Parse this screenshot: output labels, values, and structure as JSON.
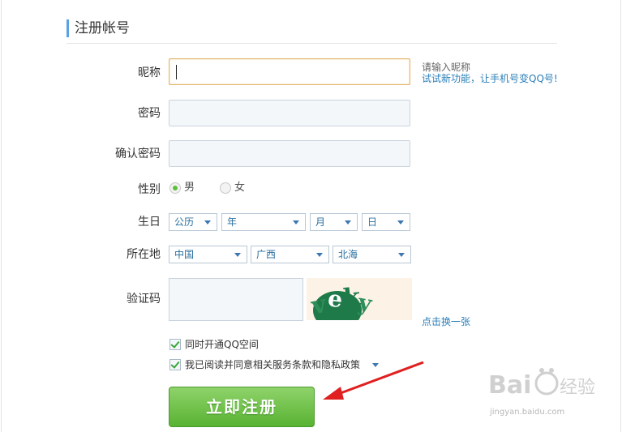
{
  "heading": "注册帐号",
  "fields": {
    "nickname_label": "昵称",
    "nickname_value": "",
    "password_label": "密码",
    "confirm_label": "确认密码",
    "gender_label": "性别",
    "birthday_label": "生日",
    "location_label": "所在地",
    "captcha_label": "验证码"
  },
  "hints": {
    "nickname": "请输入昵称",
    "phone_feature": "试试新功能，让手机号变QQ号!"
  },
  "gender": {
    "male": "男",
    "female": "女",
    "selected": "男"
  },
  "birthday": {
    "calendar": "公历",
    "year": "年",
    "month": "月",
    "day": "日"
  },
  "location": {
    "country": "中国",
    "province": "广西",
    "city": "北海"
  },
  "captcha": {
    "text": "veky",
    "refresh": "点击换一张"
  },
  "options": {
    "qzone": "同时开通QQ空间",
    "terms": "我已阅读并同意相关服务条款和隐私政策"
  },
  "register_button": "立即注册",
  "watermark": {
    "logo_text": "Bai 经验",
    "url": "jingyan.baidu.com"
  },
  "colors": {
    "accent_blue": "#2a7fb8",
    "button_green": "#58b232",
    "arrow_red": "#e02020"
  }
}
